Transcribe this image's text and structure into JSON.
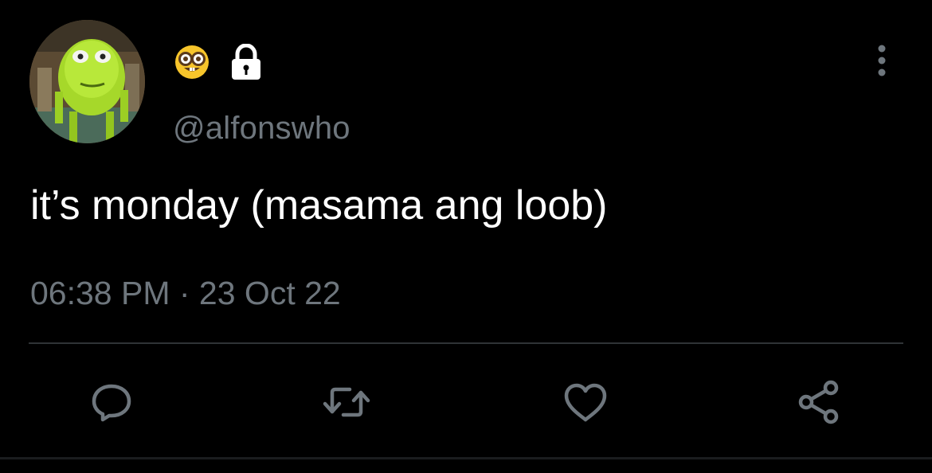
{
  "tweet": {
    "handle": "@alfonswho",
    "text": "it’s monday (masama ang loob)",
    "timestamp": "06:38 PM · 23 Oct 22",
    "name_icons": [
      "nerd-face-emoji",
      "lock-icon"
    ]
  },
  "actions": [
    {
      "name": "reply",
      "icon": "speech-bubble-icon"
    },
    {
      "name": "retweet",
      "icon": "retweet-icon"
    },
    {
      "name": "like",
      "icon": "heart-icon"
    },
    {
      "name": "share",
      "icon": "share-nodes-icon"
    }
  ],
  "colors": {
    "background": "#000000",
    "text_primary": "#ffffff",
    "text_secondary": "#6e767d",
    "icon": "#6e767d",
    "divider": "#2f3336"
  }
}
